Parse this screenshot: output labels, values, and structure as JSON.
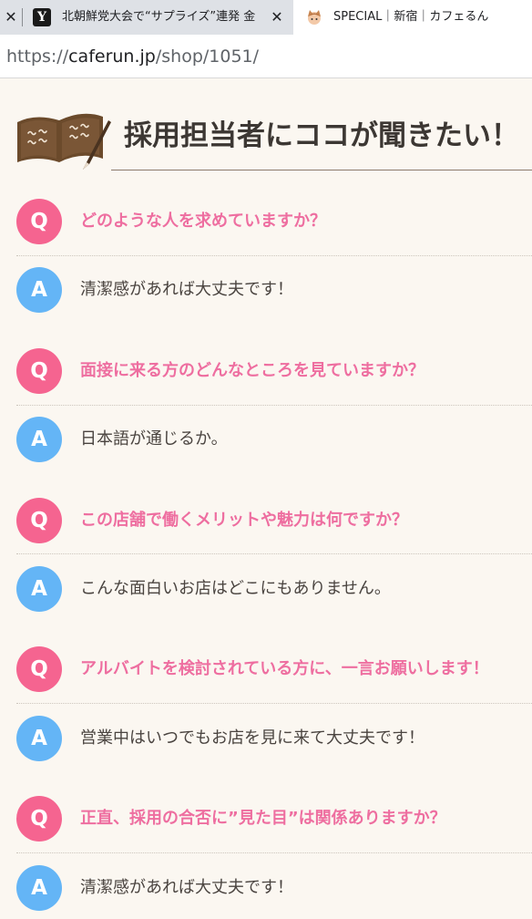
{
  "browser": {
    "tabs": [
      {
        "title": "北朝鮮党大会で“サプライズ”連発 金"
      },
      {
        "title": "SPECIAL｜新宿｜カフェるん"
      }
    ],
    "address": {
      "scheme": "https://",
      "host": "caferun.jp",
      "path": "/shop/1051/"
    }
  },
  "page": {
    "title": "採用担当者にココが聞きたい！",
    "badges": {
      "question": "Q",
      "answer": "A"
    },
    "qa": [
      {
        "question": "どのような人を求めていますか？",
        "answer": "清潔感があれば大丈夫です！"
      },
      {
        "question": "面接に来る方のどんなところを見ていますか？",
        "answer": "日本語が通じるか。"
      },
      {
        "question": "この店舗で働くメリットや魅力は何ですか？",
        "answer": "こんな面白いお店はどこにもありません。"
      },
      {
        "question": "アルバイトを検討されている方に、一言お願いします！",
        "answer": "営業中はいつでもお店を見に来て大丈夫です！"
      },
      {
        "question": "正直、採用の合否に”見た目”は関係ありますか？",
        "answer": "清潔感があれば大丈夫です！"
      }
    ]
  },
  "colors": {
    "question_badge": "#f56490",
    "answer_badge": "#64b5f6",
    "question_text": "#ee6ea0",
    "page_background": "#fbf7f1"
  }
}
